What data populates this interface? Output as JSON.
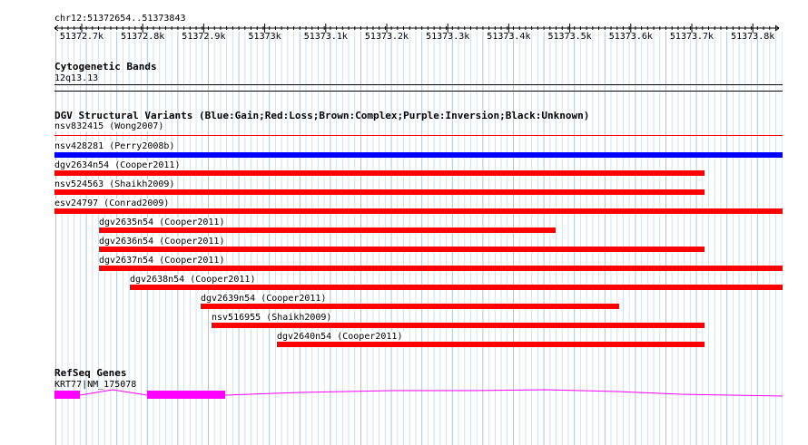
{
  "ruler": {
    "location": "chr12:51372654..51373843",
    "ticks": [
      "51372.7k",
      "51372.8k",
      "51372.9k",
      "51373k",
      "51373.1k",
      "51373.2k",
      "51373.3k",
      "51373.4k",
      "51373.5k",
      "51373.6k",
      "51373.7k",
      "51373.8k"
    ]
  },
  "cytoband": {
    "title": "Cytogenetic Bands",
    "band": "12q13.13"
  },
  "dgv": {
    "title": "DGV Structural Variants (Blue:Gain;Red:Loss;Brown:Complex;Purple:Inversion;Black:Unknown)",
    "colors": {
      "gain": "#0000ff",
      "loss": "#ff0000"
    },
    "features": [
      {
        "label": "nsv832415 (Wong2007)",
        "type": "loss",
        "thin": true
      },
      {
        "label": "nsv428281 (Perry2008b)",
        "type": "gain"
      },
      {
        "label": "dgv2634n54 (Cooper2011)",
        "type": "loss"
      },
      {
        "label": "nsv524563 (Shaikh2009)",
        "type": "loss"
      },
      {
        "label": "esv24797 (Conrad2009)",
        "type": "loss"
      },
      {
        "label": "dgv2635n54 (Cooper2011)",
        "type": "loss"
      },
      {
        "label": "dgv2636n54 (Cooper2011)",
        "type": "loss"
      },
      {
        "label": "dgv2637n54 (Cooper2011)",
        "type": "loss"
      },
      {
        "label": "dgv2638n54 (Cooper2011)",
        "type": "loss"
      },
      {
        "label": "dgv2639n54 (Cooper2011)",
        "type": "loss"
      },
      {
        "label": "nsv516955 (Shaikh2009)",
        "type": "loss"
      },
      {
        "label": "dgv2640n54 (Cooper2011)",
        "type": "loss"
      }
    ]
  },
  "refseq": {
    "title": "RefSeq Genes",
    "gene": "KRT77|NM_175078",
    "color": "#ff00ff"
  }
}
